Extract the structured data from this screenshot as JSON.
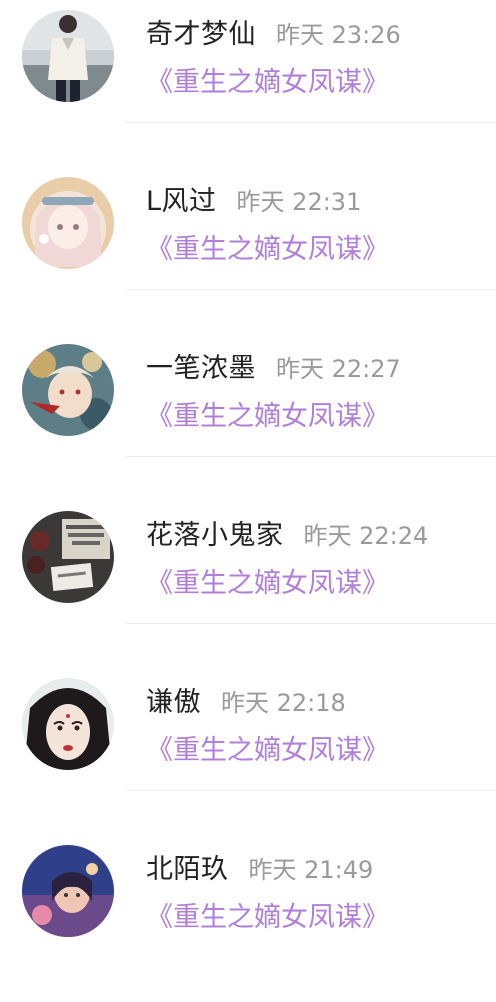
{
  "comments": [
    {
      "username": "奇才梦仙",
      "time": "昨天 23:26",
      "work_title": "《重生之嫡女凤谋》",
      "avatar_icon": "avatar-photo-person-icon"
    },
    {
      "username": "L风过",
      "time": "昨天 22:31",
      "work_title": "《重生之嫡女凤谋》",
      "avatar_icon": "avatar-anime-girl-icon"
    },
    {
      "username": "一笔浓墨",
      "time": "昨天 22:27",
      "work_title": "《重生之嫡女凤谋》",
      "avatar_icon": "avatar-illustration-icon"
    },
    {
      "username": "花落小鬼家",
      "time": "昨天 22:24",
      "work_title": "《重生之嫡女凤谋》",
      "avatar_icon": "avatar-book-rose-icon"
    },
    {
      "username": "谦傲",
      "time": "昨天 22:18",
      "work_title": "《重生之嫡女凤谋》",
      "avatar_icon": "avatar-painted-woman-icon"
    },
    {
      "username": "北陌玖",
      "time": "昨天 21:49",
      "work_title": "《重生之嫡女凤谋》",
      "avatar_icon": "avatar-blue-night-icon"
    }
  ],
  "colors": {
    "username": "#222222",
    "time": "#9a9a9a",
    "link": "#b07fd8",
    "divider": "#ececec"
  }
}
